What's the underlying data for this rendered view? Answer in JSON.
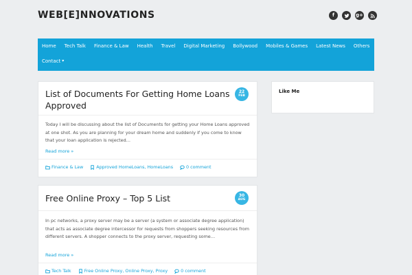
{
  "site": {
    "title": "WEB[E]NNOVATIONS"
  },
  "social": [
    {
      "name": "facebook-icon",
      "glyph": "f"
    },
    {
      "name": "twitter-icon",
      "glyph": "t"
    },
    {
      "name": "google-plus-icon",
      "glyph": "g+"
    },
    {
      "name": "rss-icon",
      "glyph": "rss"
    }
  ],
  "nav": {
    "items": [
      "Home",
      "Tech Talk",
      "Finance & Law",
      "Health",
      "Travel",
      "Digital Marketing",
      "Bollywood",
      "Mobiles & Games",
      "Latest News",
      "Others"
    ],
    "contact": "Contact"
  },
  "posts": [
    {
      "title": "List of Documents For Getting Home Loans Approved",
      "date_day": "22",
      "date_month": "FEB",
      "excerpt": "Today I will be discussing about  the list of Documents for getting your Home Loans approved at one shot. As you are planning for your dream home and suddenly if you come to know that your loan application is rejected…",
      "read_more": "Read more »",
      "category": "Finance & Law",
      "tag1": "Approved HomeLoans",
      "tag2": "HomeLoans",
      "comments": "0 comment"
    },
    {
      "title": "Free Online Proxy – Top 5 List",
      "date_day": "30",
      "date_month": "AUG",
      "excerpt": "In pc networks, a proxy server may be a server (a system or associate degree application) that acts as associate degree intercessor for requests from shoppers seeking resources from different servers. A shopper connects to the proxy server, requesting some…",
      "read_more": "Read more »",
      "category": "Tech Talk",
      "tag1": "Free Online Proxy",
      "tag2": "Online Proxy",
      "tag3": "Proxy",
      "comments": "0 comment"
    }
  ],
  "sidebar": {
    "widget_title": "Like Me"
  },
  "colors": {
    "accent": "#13a3d9",
    "badge": "#37b6e4",
    "background": "#eceef0"
  }
}
